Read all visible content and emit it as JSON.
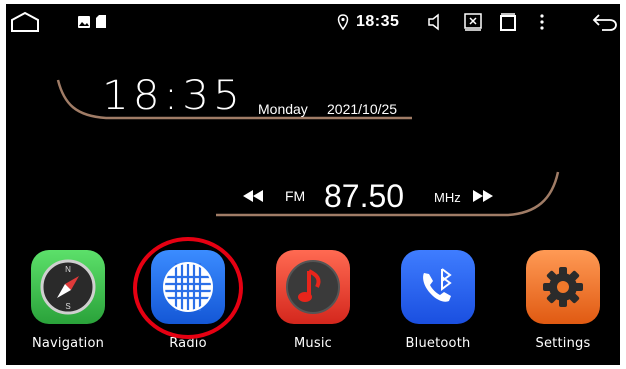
{
  "status_bar": {
    "time": "18:35",
    "icons": [
      "home-icon",
      "gallery-icon",
      "sd-card-icon",
      "location-icon",
      "volume-icon",
      "close-app-icon",
      "recents-icon",
      "menu-icon",
      "back-icon"
    ]
  },
  "clock": {
    "time": "18:35",
    "day": "Monday",
    "date": "2021/10/25"
  },
  "radio": {
    "band": "FM",
    "frequency": "87.50",
    "unit": "MHz"
  },
  "apps": [
    {
      "label": "Navigation",
      "icon": "compass-icon"
    },
    {
      "label": "Radio",
      "icon": "radio-grille-icon"
    },
    {
      "label": "Music",
      "icon": "music-note-icon"
    },
    {
      "label": "Bluetooth",
      "icon": "bluetooth-phone-icon"
    },
    {
      "label": "Settings",
      "icon": "gear-icon"
    }
  ],
  "colors": {
    "background": "#000000",
    "arc": "#a07c66",
    "highlight": "#e60012"
  }
}
